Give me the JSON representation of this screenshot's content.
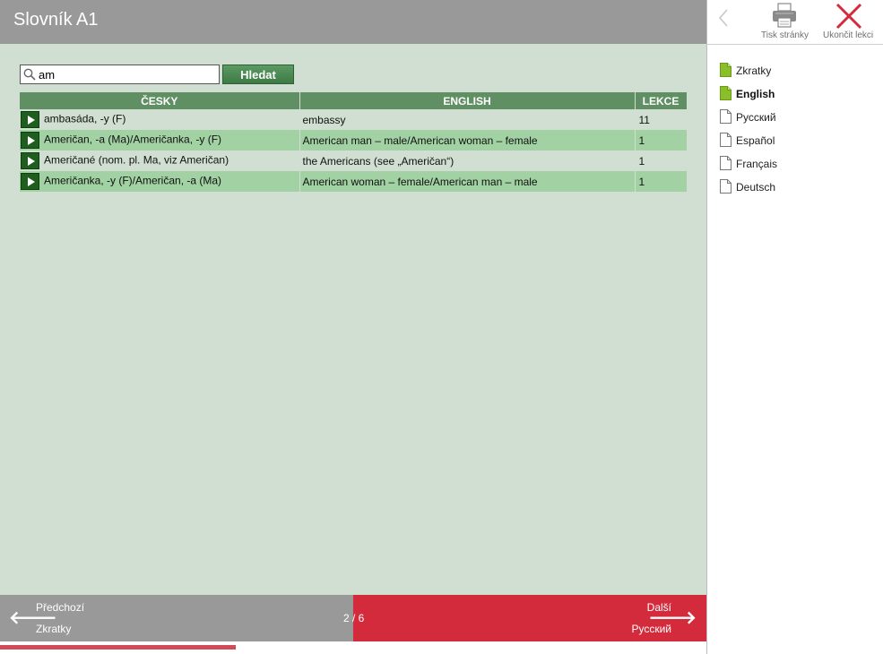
{
  "header": {
    "title": "Slovník A1"
  },
  "search": {
    "value": "am",
    "button_label": "Hledat"
  },
  "table": {
    "columns": [
      "ČESKY",
      "ENGLISH",
      "LEKCE"
    ],
    "rows": [
      {
        "cz": "ambasáda, -y (F)",
        "en": "embassy",
        "lekce": "11"
      },
      {
        "cz": "Američan, -a (Ma)/Američanka, -y (F)",
        "en": "American man – male/American woman – female",
        "lekce": "1"
      },
      {
        "cz": "Američané (nom. pl. Ma, viz Američan)",
        "en": "the Americans (see „Američan“)",
        "lekce": "1"
      },
      {
        "cz": "Američanka, -y (F)/Američan, -a (Ma)",
        "en": "American woman – female/American man – male",
        "lekce": "1"
      }
    ]
  },
  "footer": {
    "prev_title": "Předchozí",
    "prev_sub": "Zkratky",
    "next_title": "Další",
    "next_sub": "Русский",
    "page_indicator": "2 / 6",
    "progress": 0.333
  },
  "toolbar": {
    "print_label": "Tisk stránky",
    "close_label": "Ukončit lekci"
  },
  "languages": [
    {
      "label": "Zkratky",
      "state": "visited",
      "icon": "document-filled-icon"
    },
    {
      "label": "English",
      "state": "current",
      "icon": "document-filled-icon"
    },
    {
      "label": "Русский",
      "state": "unvisited",
      "icon": "document-outline-icon"
    },
    {
      "label": "Español",
      "state": "unvisited",
      "icon": "document-outline-icon"
    },
    {
      "label": "Français",
      "state": "unvisited",
      "icon": "document-outline-icon"
    },
    {
      "label": "Deutsch",
      "state": "unvisited",
      "icon": "document-outline-icon"
    }
  ],
  "colors": {
    "header_bg": "#999999",
    "main_bg": "#d0dfd1",
    "row_alt_bg": "#a2d2a4",
    "table_header_bg": "#5f8f63",
    "next_bg": "#d42b3c",
    "doc_icon_green": "#8bbf2a"
  }
}
